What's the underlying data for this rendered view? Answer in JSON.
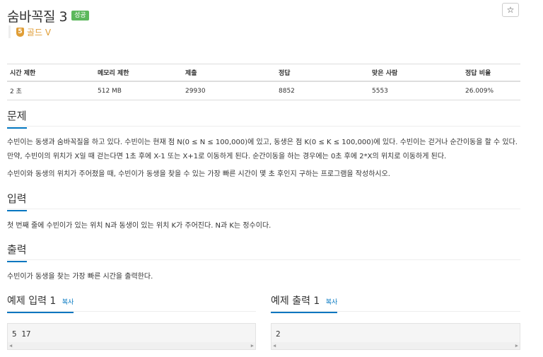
{
  "problem": {
    "title": "숨바꼭질 3",
    "status_badge": "성공",
    "tier_number": "5",
    "tier_label": "골드 V",
    "star_icon": "☆"
  },
  "info_table": {
    "headers": [
      "시간 제한",
      "메모리 제한",
      "제출",
      "정답",
      "맞은 사람",
      "정답 비율"
    ],
    "values": [
      "2 초",
      "512 MB",
      "29930",
      "8852",
      "5553",
      "26.009%"
    ]
  },
  "sections": {
    "problem_title": "문제",
    "problem_text_1": "수빈이는 동생과 숨바꼭질을 하고 있다. 수빈이는 현재 점 N(0 ≤ N ≤ 100,000)에 있고, 동생은 점 K(0 ≤ K ≤ 100,000)에 있다. 수빈이는 걷거나 순간이동을 할 수 있다. 만약, 수빈이의 위치가 X일 때 걷는다면 1초 후에 X-1 또는 X+1로 이동하게 된다. 순간이동을 하는 경우에는 0초 후에 2*X의 위치로 이동하게 된다.",
    "problem_text_2": "수빈이와 동생의 위치가 주어졌을 때, 수빈이가 동생을 찾을 수 있는 가장 빠른 시간이 몇 초 후인지 구하는 프로그램을 작성하시오.",
    "input_title": "입력",
    "input_text": "첫 번째 줄에 수빈이가 있는 위치 N과 동생이 있는 위치 K가 주어진다. N과 K는 정수이다.",
    "output_title": "출력",
    "output_text": "수빈이가 동생을 찾는 가장 빠른 시간을 출력한다."
  },
  "samples": {
    "input_title": "예제 입력 1",
    "input_copy": "복사",
    "input_value": "5 17",
    "output_title": "예제 출력 1",
    "output_copy": "복사",
    "output_value": "2"
  }
}
